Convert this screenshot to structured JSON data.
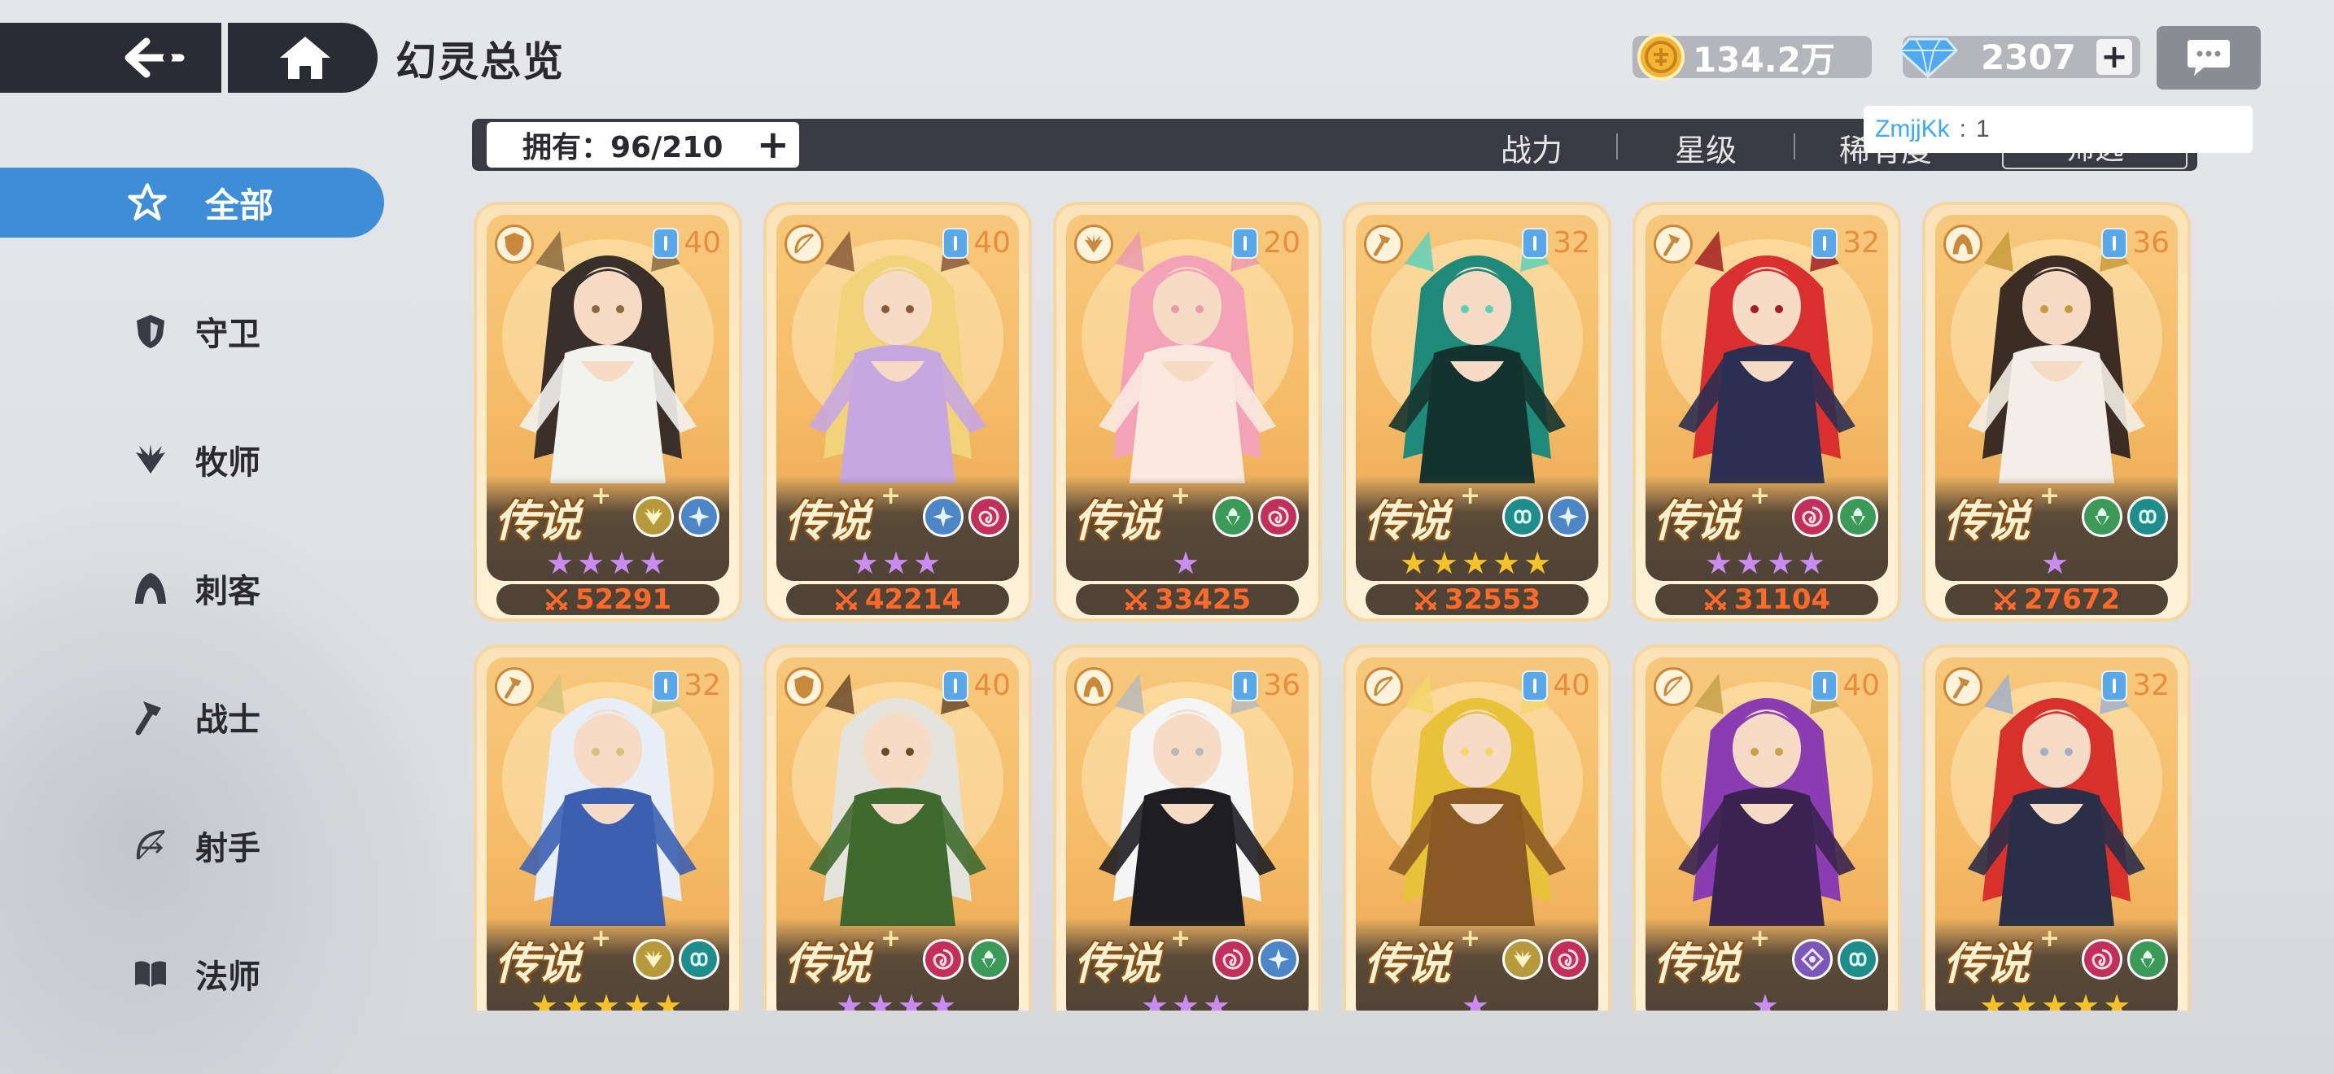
{
  "header": {
    "title": "幻灵总览",
    "back_icon": "back-arrow-icon",
    "home_icon": "home-icon"
  },
  "currencies": {
    "gold": {
      "value": "134.2万",
      "icon": "gold-coin-icon"
    },
    "gem": {
      "value": "2307",
      "icon": "blue-gem-icon",
      "plus": "+"
    }
  },
  "chat": {
    "icon": "chat-bubble-icon",
    "tooltip_user": "ZmjjKk",
    "tooltip_sep": ":",
    "tooltip_count": "1"
  },
  "sidebar": {
    "items": [
      {
        "label": "全部",
        "icon": "star-all-icon",
        "active": true
      },
      {
        "label": "守卫",
        "icon": "shield-icon",
        "active": false
      },
      {
        "label": "牧师",
        "icon": "wings-icon",
        "active": false
      },
      {
        "label": "刺客",
        "icon": "hood-icon",
        "active": false
      },
      {
        "label": "战士",
        "icon": "axe-icon",
        "active": false
      },
      {
        "label": "射手",
        "icon": "bow-icon",
        "active": false
      },
      {
        "label": "法师",
        "icon": "book-icon",
        "active": false
      }
    ]
  },
  "sortbar": {
    "owned_label": "拥有：96/210",
    "plus": "+",
    "options": [
      "战力",
      "星级",
      "稀有度"
    ],
    "filter_label": "筛选"
  },
  "cards": [
    {
      "class_icon": "shield-icon",
      "level": "40",
      "rarity": "传说",
      "rarity_plus": "+",
      "elements": [
        "light-wing-icon",
        "ice-star-icon"
      ],
      "stars": "★★★★",
      "star_count": 4,
      "star_color": "purple",
      "power": "52291",
      "palette": [
        "#3b2f2a",
        "#f2f2ee",
        "#8b6b3d"
      ]
    },
    {
      "class_icon": "bow-icon",
      "level": "40",
      "rarity": "传说",
      "rarity_plus": "+",
      "elements": [
        "ice-star-icon",
        "fire-swirl-icon"
      ],
      "stars": "★★★",
      "star_count": 3,
      "star_color": "purple",
      "power": "42214",
      "palette": [
        "#f1d47a",
        "#c7a7e0",
        "#8a5a38"
      ]
    },
    {
      "class_icon": "wings-icon",
      "level": "20",
      "rarity": "传说",
      "rarity_plus": "+",
      "elements": [
        "nature-leaf-icon",
        "fire-swirl-icon"
      ],
      "stars": "★",
      "star_count": 1,
      "star_color": "purple",
      "power": "33425",
      "palette": [
        "#f3a3b5",
        "#fbe9e0",
        "#e99aab"
      ]
    },
    {
      "class_icon": "axe-icon",
      "level": "32",
      "rarity": "传说",
      "rarity_plus": "+",
      "elements": [
        "water-loop-icon",
        "ice-star-icon"
      ],
      "stars": "★★★★★",
      "star_count": 5,
      "star_color": "gold",
      "power": "32553",
      "palette": [
        "#1f8a7a",
        "#14332e",
        "#5fd0b7"
      ]
    },
    {
      "class_icon": "axe-icon",
      "level": "32",
      "rarity": "传说",
      "rarity_plus": "+",
      "elements": [
        "fire-swirl-icon",
        "nature-leaf-icon"
      ],
      "stars": "★★★★",
      "star_count": 4,
      "star_color": "purple",
      "power": "31104",
      "palette": [
        "#d9302f",
        "#2b2f52",
        "#a02020"
      ]
    },
    {
      "class_icon": "hood-icon",
      "level": "36",
      "rarity": "传说",
      "rarity_plus": "+",
      "elements": [
        "nature-leaf-icon",
        "water-loop-icon"
      ],
      "stars": "★",
      "star_count": 1,
      "star_color": "purple",
      "power": "27672",
      "palette": [
        "#3b2c24",
        "#f4efe6",
        "#c79a3a"
      ]
    },
    {
      "class_icon": "axe-icon",
      "level": "32",
      "rarity": "传说",
      "rarity_plus": "+",
      "elements": [
        "light-wing-icon",
        "water-loop-icon"
      ],
      "stars": "★★★★★",
      "star_count": 5,
      "star_color": "gold",
      "power": "",
      "palette": [
        "#e8eef7",
        "#3c5fb0",
        "#d6c27a"
      ]
    },
    {
      "class_icon": "shield-icon",
      "level": "40",
      "rarity": "传说",
      "rarity_plus": "+",
      "elements": [
        "fire-swirl-icon",
        "nature-leaf-icon"
      ],
      "stars": "★★★★",
      "star_count": 4,
      "star_color": "purple",
      "power": "",
      "palette": [
        "#e4e4dc",
        "#3f6a2f",
        "#6b4a2a"
      ]
    },
    {
      "class_icon": "hood-icon",
      "level": "36",
      "rarity": "传说",
      "rarity_plus": "+",
      "elements": [
        "fire-swirl-icon",
        "ice-star-icon"
      ],
      "stars": "★★★",
      "star_count": 3,
      "star_color": "purple",
      "power": "",
      "palette": [
        "#f5f5f5",
        "#1e1e22",
        "#b9b9b9"
      ]
    },
    {
      "class_icon": "bow-icon",
      "level": "40",
      "rarity": "传说",
      "rarity_plus": "+",
      "elements": [
        "light-wing-icon",
        "fire-swirl-icon"
      ],
      "stars": "★",
      "star_count": 1,
      "star_color": "purple",
      "power": "",
      "palette": [
        "#e8c33a",
        "#8a5a24",
        "#f3d76a"
      ]
    },
    {
      "class_icon": "bow-icon",
      "level": "40",
      "rarity": "传说",
      "rarity_plus": "+",
      "elements": [
        "dark-eye-icon",
        "water-loop-icon"
      ],
      "stars": "★",
      "star_count": 1,
      "star_color": "purple",
      "power": "",
      "palette": [
        "#8a3db0",
        "#3a2350",
        "#c7a24a"
      ]
    },
    {
      "class_icon": "axe-icon",
      "level": "32",
      "rarity": "传说",
      "rarity_plus": "+",
      "elements": [
        "fire-swirl-icon",
        "nature-leaf-icon"
      ],
      "stars": "★★★★★",
      "star_count": 5,
      "star_color": "gold",
      "power": "",
      "palette": [
        "#d8302a",
        "#2a2f48",
        "#9fb0c8"
      ]
    }
  ],
  "colors": {
    "accent": "#3d8ed6",
    "dark_bar": "#2b2c33",
    "power": "#ff6a2a",
    "level": "#e88c3d",
    "star_purple": "#c98cf2",
    "star_gold": "#f5c22a"
  }
}
